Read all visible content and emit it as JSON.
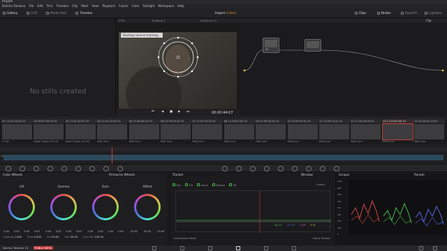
{
  "app": {
    "title": "Import"
  },
  "menu": [
    "DaVinci Resolve",
    "File",
    "Edit",
    "Trim",
    "Timeline",
    "Clip",
    "Mark",
    "View",
    "Playback",
    "Fusion",
    "Color",
    "Fairlight",
    "Workspace",
    "Help"
  ],
  "toolbar": {
    "gallery": "Gallery",
    "luts": "LUTs",
    "media_pool": "Media Pool",
    "timeline": "Timeline",
    "project_name": "Import",
    "edited": "Edited",
    "clips": "Clips",
    "nodes": "Nodes",
    "openfx": "OpenFX",
    "lightbox": "Lightbox"
  },
  "gallery": {
    "empty_text": "No stills created"
  },
  "viewer": {
    "zoom": "27%",
    "timeline_name": "Timeline 1",
    "timecode_top": "00:00:44:11",
    "tooltip": "Starting reverse tracking...",
    "timecode": "00:00:44:07"
  },
  "nodes": {
    "mode": "Clip",
    "node_label": "01"
  },
  "clips": [
    {
      "num": "01",
      "tc": "11:51:24:22",
      "track": "V1",
      "label": "H.264"
    },
    {
      "num": "02",
      "tc": "00:57:50:02",
      "track": "V1",
      "label": "Apple ProRes 422 HQ"
    },
    {
      "num": "03",
      "tc": "11:51:24:07",
      "track": "V1",
      "label": "Apple ProRes 422 HQ"
    },
    {
      "num": "04",
      "tc": "11:51:22:02",
      "track": "V1",
      "label": "RAW Intra"
    },
    {
      "num": "05",
      "tc": "11:48:30:22",
      "track": "V1",
      "label": "RAW Intra"
    },
    {
      "num": "06",
      "tc": "11:53:25:22",
      "track": "V1",
      "label": "RAW Intra"
    },
    {
      "num": "07",
      "tc": "11:53:15:19",
      "track": "V1",
      "label": "RAW Intra"
    },
    {
      "num": "08",
      "tc": "11:53:07:02",
      "track": "V1",
      "label": "RAW Intra"
    },
    {
      "num": "09",
      "tc": "11:53:20:20",
      "track": "V1",
      "label": "RAW Intra"
    },
    {
      "num": "10",
      "tc": "11:53:10:01",
      "track": "V1",
      "label": "RAW Intra"
    },
    {
      "num": "11",
      "tc": "11:53:13:11",
      "track": "V1",
      "label": "RAW Intra"
    },
    {
      "num": "12",
      "tc": "11:34:25:16",
      "track": "V1",
      "label": "RAW Intra"
    },
    {
      "num": "13",
      "tc": "11:53:02:04",
      "track": "V1",
      "label": "RAW Intra"
    },
    {
      "num": "14",
      "tc": "10:24:01:13",
      "track": "V1",
      "label": "RAW Intra"
    }
  ],
  "timeline": {
    "track": "V1"
  },
  "color_wheels": {
    "title": "Color Wheels",
    "mode": "Primaries Wheels",
    "wheels": [
      {
        "label": "Lift",
        "values": [
          "0.00",
          "0.00",
          "0.00",
          "0.00"
        ]
      },
      {
        "label": "Gamma",
        "values": [
          "0.00",
          "0.00",
          "0.00",
          "0.00"
        ]
      },
      {
        "label": "Gain",
        "values": [
          "1.00",
          "1.00",
          "1.00",
          "1.00"
        ]
      },
      {
        "label": "Offset",
        "values": [
          "25.00",
          "25.00",
          "25.00"
        ]
      }
    ],
    "footer": [
      {
        "label": "Contrast",
        "value": "1.000"
      },
      {
        "label": "Pivot",
        "value": "0.435"
      },
      {
        "label": "Sat",
        "value": "50.00"
      },
      {
        "label": "Hue",
        "value": "50.00"
      },
      {
        "label": "Lum Mix",
        "value": "100.00"
      }
    ]
  },
  "tracker": {
    "title": "Tracker",
    "mode": "Window",
    "options": [
      "Pan",
      "Tilt",
      "Zoom",
      "Rotate",
      "3D"
    ],
    "frame": "Frame",
    "values": [
      "44.22",
      "-15.54",
      "1.09",
      "0.31"
    ],
    "interactive_mode": "Interactive Mode",
    "tracker_type": "Cloud Tracker"
  },
  "scopes": {
    "title": "Scopes",
    "mode": "Parade",
    "ticks": [
      "1023",
      "896",
      "768",
      "640",
      "512",
      "384",
      "256",
      "128",
      "0"
    ]
  },
  "status": {
    "app_name": "DaVinci Resolve 15",
    "beta": "PUBLIC BETA"
  }
}
